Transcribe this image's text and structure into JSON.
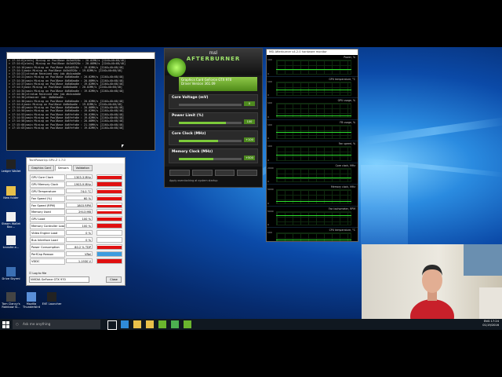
{
  "console": {
    "title": "",
    "lines": [
      "> 17:14:0[stats] Mining on PoolBase 4b3d4928c : 20.02MH/s [2240+40=68/48]",
      "> 17:14:0[stats] Mining on PoolBase 4b3d4928c : 20.08MH/s [2240+40=68/48]",
      "> 17:14:16|main  Mining on PoolBase 4b3d4928c : 19.82MH/s [2240+40=68/48]",
      "> 17:14:1|main  Mining on PoolBase 4b3d4928c : 19.82MH/s [2240+40=68/48]",
      "> 17:14:21|stratum  Received new job #b4cada0e",
      "> 17:14:21|main  Mining on PoolBase 4b8b6aa6e : 20.02MH/s [2240+40=68/48]",
      "> 17:14:26|main  Mining on PoolBase 4b8b6aa6e : 20.08MH/s [2240+40=68/48]",
      "> 17:14:27|main  Mining on PoolBase 4b8b6aa6e : 19.82MH/s [2240+40=68/48]",
      "> 17:14:3|main  Mining on PoolBase 4b8b6aa6e : 20.02MH/s [2240+40=68/48]",
      "> 17:14:34|main  Mining on PoolBase 4b8b6aa6e : 19.82MH/s [2240+40=68/48]",
      "> 17:14:36|stratum  Received new job #b4cada0e",
      "> 17:14:36|ethminer  Job: 4b8b6aa6e..",
      "> 17:14:38|main  Mining on PoolBase 4b8b6aa6e : 20.02MH/s [2240+40=68/48]",
      "> 17:14:4|main  Mining on PoolBase 4b8b6aa6e : 19.82MH/s [2240+40=68/48]",
      "> 17:14:48|main  Mining on PoolBase 4b8b6aa6e : 20.08MH/s [2240+40=68/48]",
      "> 17:14:50|main  Mining on PoolBase 4b8b6aa6e : 19.82MH/s [2240+40=68/48]",
      "> 17:14:53|main  Mining on PoolBase 4b8fefa6e : 20.02MH/s [2240+40=68/48]",
      "> 17:14:55|main  Mining on PoolBase 4b8fefa6e : 19.82MH/s [2240+40=68/48]",
      "> 17:14:58|main  Mining on PoolBase 4b8fefa6e : 20.08MH/s [2240+40=68/48]",
      "> 17:15:00|main  Mining on PoolBase 4b8fefa6e : 21.50MH/s [2240+40=68/48]",
      "> 17:15:03|main  Mining on PoolBase 4b8fefa6e : 19.82MH/s [2240+40=68/48]"
    ]
  },
  "afterburner": {
    "brand": "msi",
    "title": "AFTERBURNER",
    "card_line1": "Graphics Card  GeForce GTX 970",
    "card_line2": "Driver Version  361.09",
    "sliders": [
      {
        "label": "Core Voltage (mV)",
        "value": "0",
        "level": 0.0
      },
      {
        "label": "Power Limit (%)",
        "value": "100",
        "level": 0.75
      },
      {
        "label": "Core Clock (MHz)",
        "value": "+100",
        "level": 0.62
      },
      {
        "label": "Memory Clock (MHz)",
        "value": "+500",
        "level": 0.55
      },
      {
        "label": "Fan Speed (%)",
        "value": "70",
        "level": 0.7
      }
    ],
    "startup_text": "Apply overclocking at system startup"
  },
  "hw_monitor": {
    "title": "MSI Afterburner v4.2.0 hardware monitor",
    "graphs": [
      {
        "label": "Power, %",
        "top": "100",
        "bottom": "0",
        "trace": 0.35
      },
      {
        "label": "GPU temperature, °C",
        "top": "100",
        "bottom": "0",
        "trace": 0.45
      },
      {
        "label": "GPU usage, %",
        "top": "100",
        "bottom": "0",
        "trace": 0.1
      },
      {
        "label": "FB usage, %",
        "top": "100",
        "bottom": "0",
        "trace": 0.5
      },
      {
        "label": "Fan speed, %",
        "top": "100",
        "bottom": "0",
        "trace": 0.4
      },
      {
        "label": "Core clock, MHz",
        "top": "2000",
        "bottom": "0",
        "trace": 0.3
      },
      {
        "label": "Memory clock, MHz",
        "top": "5000",
        "bottom": "0",
        "trace": 0.2
      },
      {
        "label": "Fan tachometer, RPM",
        "top": "5000",
        "bottom": "0",
        "trace": 0.75
      },
      {
        "label": "CPU temperature, °C",
        "top": "100",
        "bottom": "0",
        "trace": 0.55
      }
    ]
  },
  "gpuz": {
    "title": "TechPowerUp GPU-Z 1.7.0",
    "tabs": [
      "Graphics Card",
      "Sensors",
      "Validation"
    ],
    "rows": [
      {
        "name": "GPU Core Clock",
        "value": "1303.3 MHz",
        "level": 0.9,
        "color": "#e01010"
      },
      {
        "name": "GPU Memory Clock",
        "value": "1903.9 MHz",
        "level": 0.9,
        "color": "#e01010"
      },
      {
        "name": "GPU Temperature",
        "value": "74.0 °C",
        "level": 0.8,
        "color": "#e01010"
      },
      {
        "name": "Fan Speed (%)",
        "value": "60 %",
        "level": 0.7,
        "color": "#e01010"
      },
      {
        "name": "Fan Speed (RPM)",
        "value": "1803 RPM",
        "level": 0.6,
        "color": "#e01010"
      },
      {
        "name": "Memory Used",
        "value": "2913 MB",
        "level": 0.7,
        "color": "#e01010"
      },
      {
        "name": "GPU Load",
        "value": "100 %",
        "level": 0.95,
        "color": "#e01010"
      },
      {
        "name": "Memory Controller Load",
        "value": "100 %",
        "level": 0.95,
        "color": "#e01010"
      },
      {
        "name": "Video Engine Load",
        "value": "0 %",
        "level": 0.0,
        "color": "#e01010"
      },
      {
        "name": "Bus Interface Load",
        "value": "0 %",
        "level": 0.0,
        "color": "#e01010"
      },
      {
        "name": "Power Consumption",
        "value": "80.2 % TDP",
        "level": 0.75,
        "color": "#e01010"
      },
      {
        "name": "PerfCap Reason",
        "value": "VRel",
        "level": 1.0,
        "color": "#3b9de0"
      },
      {
        "name": "VDDC",
        "value": "1.1930 V",
        "level": 0.85,
        "color": "#e01010"
      }
    ],
    "log_label": "Log to file",
    "gpu_select": "NVIDIA GeForce GTX 970",
    "close_label": "Close"
  },
  "desktop_icons": [
    {
      "label": "Ledger Wallet",
      "color": "#222"
    },
    {
      "label": "New folder",
      "color": "#e8c04a"
    },
    {
      "label": "Steam Wallet Bac...",
      "color": "#f0f0f0"
    },
    {
      "label": "transfer.e...",
      "color": "#f0f0f0"
    },
    {
      "label": "Drive Skyrmi",
      "color": "#3b6fb3"
    },
    {
      "label": "Tom Clancy's Rainbow Si...",
      "color": "#444"
    },
    {
      "label": "Mozilla Thunderbird",
      "color": "#5a8fd8"
    },
    {
      "label": "EVE Launcher",
      "color": "#222"
    }
  ],
  "taskbar": {
    "search_placeholder": "Ask me anything",
    "apps": [
      {
        "name": "task-view",
        "color": "#ffffff"
      },
      {
        "name": "edge",
        "color": "#2f8bd8"
      },
      {
        "name": "file-explorer",
        "color": "#e8c04a"
      },
      {
        "name": "store",
        "color": "#e8c04a"
      },
      {
        "name": "afterburner",
        "color": "#6ab52e"
      },
      {
        "name": "gpuz",
        "color": "#4caf50"
      },
      {
        "name": "ethminer",
        "color": "#6ab52e"
      }
    ],
    "time": "17:24",
    "date": "01/19/2016",
    "lang": "ENG"
  }
}
